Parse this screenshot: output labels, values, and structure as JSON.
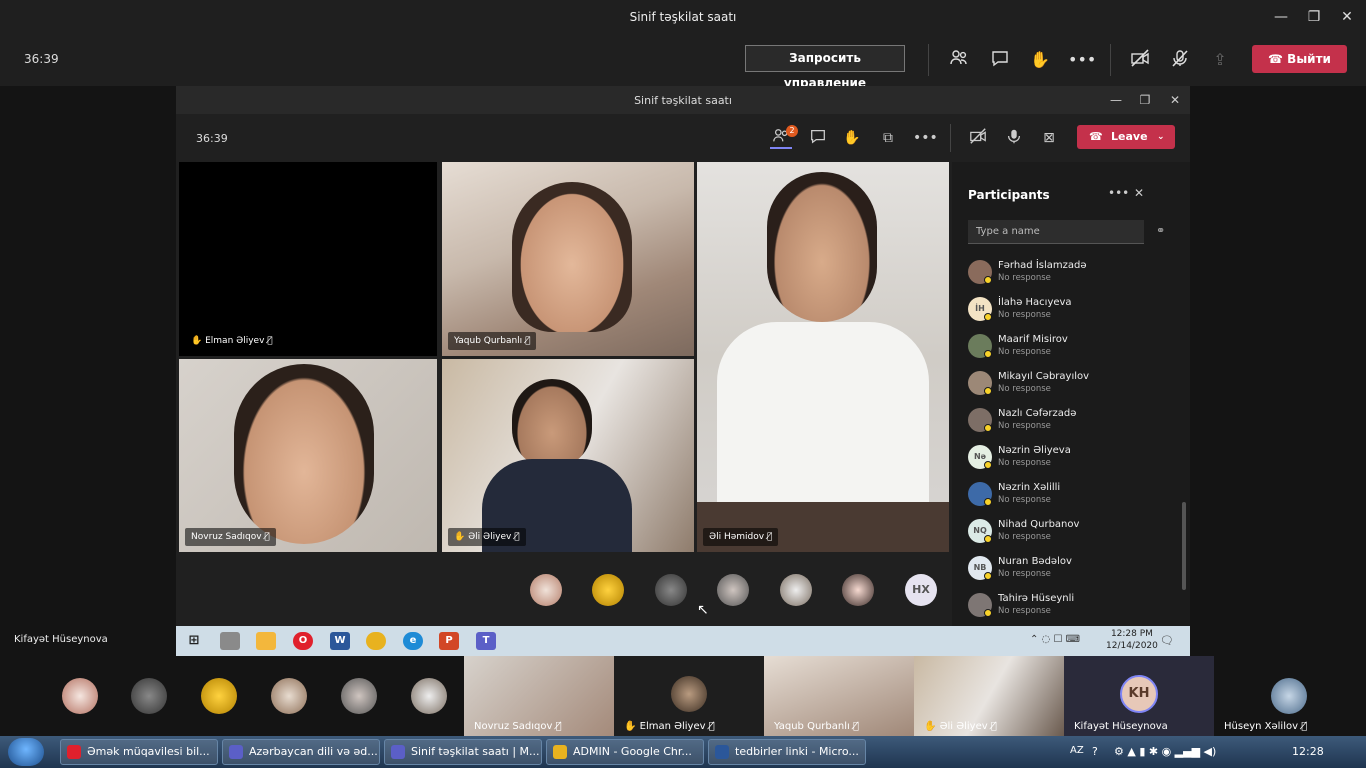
{
  "outer": {
    "title": "Sinif təşkilat saatı",
    "timer": "36:39",
    "request_control": "Запросить управление",
    "leave": "Выйти",
    "presenter": "Kifayət Hüseynova"
  },
  "inner": {
    "title": "Sinif təşkilat saatı",
    "timer": "36:39",
    "participants_badge": "2",
    "leave": "Leave",
    "tiles": [
      {
        "name": "Elman Əliyev",
        "hand": "✋"
      },
      {
        "name": "Yaqub Qurbanlı"
      },
      {
        "name": "Əli Həmidov"
      },
      {
        "name": "Novruz Sadıqov"
      },
      {
        "name": "Əli Əliyev",
        "hand": "✋"
      }
    ],
    "bubble_initials": "HX",
    "panel": {
      "title": "Participants",
      "search_placeholder": "Type a name",
      "items": [
        {
          "name": "Fərhad İslamzadə",
          "status": "No response",
          "initials": "",
          "color": "#8a6b5c"
        },
        {
          "name": "İlahə Hacıyeva",
          "status": "No response",
          "initials": "İH",
          "color": "#f3e3c4"
        },
        {
          "name": "Maarif Misirov",
          "status": "No response",
          "initials": "",
          "color": "#6b7c5c"
        },
        {
          "name": "Mikayıl Cəbrayılov",
          "status": "No response",
          "initials": "",
          "color": "#9c8877"
        },
        {
          "name": "Nazlı Cəfərzadə",
          "status": "No response",
          "initials": "",
          "color": "#7d6e66"
        },
        {
          "name": "Nəzrin Əliyeva",
          "status": "No response",
          "initials": "Nə",
          "color": "#e5efe3"
        },
        {
          "name": "Nəzrin Xəlilli",
          "status": "No response",
          "initials": "",
          "color": "#3d6aa8"
        },
        {
          "name": "Nihad Qurbanov",
          "status": "No response",
          "initials": "NQ",
          "color": "#dbeae6"
        },
        {
          "name": "Nuran Bədəlov",
          "status": "No response",
          "initials": "NB",
          "color": "#e1e8ef"
        },
        {
          "name": "Tahirə Hüseynli",
          "status": "No response",
          "initials": "",
          "color": "#7e7674"
        }
      ]
    },
    "taskbar": {
      "time": "12:28 PM",
      "date": "12/14/2020"
    }
  },
  "strip": {
    "tiles": [
      {
        "name": "Novruz Sadıqov"
      },
      {
        "name": "Elman Əliyev",
        "hand": "✋"
      },
      {
        "name": "Yaqub Qurbanlı"
      },
      {
        "name": "Əli Əliyev",
        "hand": "✋"
      },
      {
        "name": "Kifayət Hüseynova",
        "initials": "KH"
      },
      {
        "name": "Hüseyn Xəlilov"
      }
    ]
  },
  "taskbar": {
    "tasks": [
      {
        "label": "Əmək müqavilesi bil...",
        "color": "#e0202c"
      },
      {
        "label": "Azərbaycan dili və əd...",
        "color": "#5b5fc7"
      },
      {
        "label": "Sinif təşkilat saatı | M...",
        "color": "#5b5fc7"
      },
      {
        "label": "ADMIN - Google Chr...",
        "color": "#e8b21f"
      },
      {
        "label": "tedbirler linki - Micro...",
        "color": "#2b579a"
      }
    ],
    "lang": "AZ",
    "clock": "12:28"
  }
}
